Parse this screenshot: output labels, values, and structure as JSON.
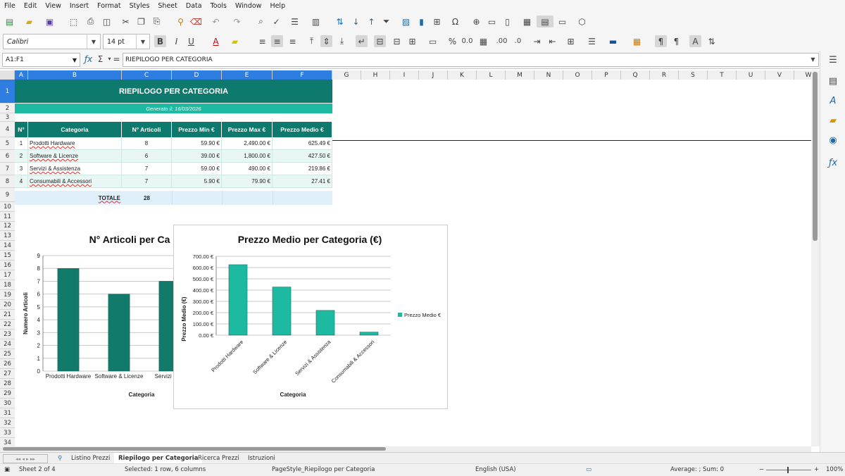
{
  "menu": [
    "File",
    "Edit",
    "View",
    "Insert",
    "Format",
    "Styles",
    "Sheet",
    "Data",
    "Tools",
    "Window",
    "Help"
  ],
  "toolbar": {
    "font_name": "Calibri",
    "font_size": "14 pt"
  },
  "formula": {
    "cell_ref": "A1:F1",
    "content": "RIEPILOGO PER CATEGORIA"
  },
  "columns": [
    "A",
    "B",
    "C",
    "D",
    "E",
    "F",
    "G",
    "H",
    "I",
    "J",
    "K",
    "L",
    "M",
    "N",
    "O",
    "P",
    "Q",
    "R",
    "S",
    "T",
    "U",
    "V",
    "W"
  ],
  "rows": [
    "1",
    "2",
    "3",
    "4",
    "5",
    "6",
    "7",
    "8",
    "9",
    "10",
    "11",
    "12",
    "13",
    "14",
    "15",
    "16",
    "17",
    "18",
    "19",
    "20",
    "21",
    "22",
    "23",
    "24",
    "25",
    "26",
    "27",
    "28",
    "29",
    "30",
    "31",
    "32",
    "33",
    "34"
  ],
  "sheet": {
    "title": "RIEPILOGO PER CATEGORIA",
    "subtitle": "Generato il: 16/03/2026",
    "headers": [
      "N°",
      "Categoria",
      "N° Articoli",
      "Prezzo Min €",
      "Prezzo Max €",
      "Prezzo Medio €"
    ],
    "data_rows": [
      [
        "1",
        "Prodotti Hardware",
        "8",
        "59.90 €",
        "2,490.00 €",
        "625.49 €"
      ],
      [
        "2",
        "Software & Licenze",
        "6",
        "39.00 €",
        "1,800.00 €",
        "427.50 €"
      ],
      [
        "3",
        "Servizi & Assistenza",
        "7",
        "59.00 €",
        "490.00 €",
        "219.86 €"
      ],
      [
        "4",
        "Consumabili & Accessori",
        "7",
        "5.90 €",
        "79.90 €",
        "27.41 €"
      ]
    ],
    "total_label": "TOTALE",
    "total_value": "28"
  },
  "chart_data": [
    {
      "type": "bar",
      "title": "N° Articoli per Ca",
      "xlabel": "Categoria",
      "ylabel": "Numero Articoli",
      "categories": [
        "Prodotti Hardware",
        "Software & Licenze",
        "Servizi & As"
      ],
      "values": [
        8,
        6,
        7
      ],
      "ylim": [
        0,
        9
      ],
      "yticks": [
        "0",
        "1",
        "2",
        "3",
        "4",
        "5",
        "6",
        "7",
        "8",
        "9"
      ],
      "color": "#127a6b"
    },
    {
      "type": "bar",
      "title": "Prezzo Medio per Categoria (€)",
      "xlabel": "Categoria",
      "ylabel": "Prezzo Medio (€)",
      "categories": [
        "Prodotti Hardware",
        "Software & Licenze",
        "Servizi & Assistenza",
        "Consumabili & Accessori"
      ],
      "values": [
        625.49,
        427.5,
        219.86,
        27.41
      ],
      "ylim": [
        0,
        700
      ],
      "yticks": [
        "0.00 €",
        "100.00 €",
        "200.00 €",
        "300.00 €",
        "400.00 €",
        "500.00 €",
        "600.00 €",
        "700.00 €"
      ],
      "legend": "Prezzo Medio €",
      "color": "#1db9a1"
    }
  ],
  "tabs": [
    "Listino Prezzi",
    "Riepilogo per Categoria",
    "Ricerca Prezzi",
    "Istruzioni"
  ],
  "status": {
    "sheet": "Sheet 2 of 4",
    "selection": "Selected: 1 row, 6 columns",
    "pagestyle": "PageStyle_Riepilogo per Categoria",
    "language": "English (USA)",
    "sum": "Average: ; Sum: 0",
    "zoom": "100%"
  }
}
